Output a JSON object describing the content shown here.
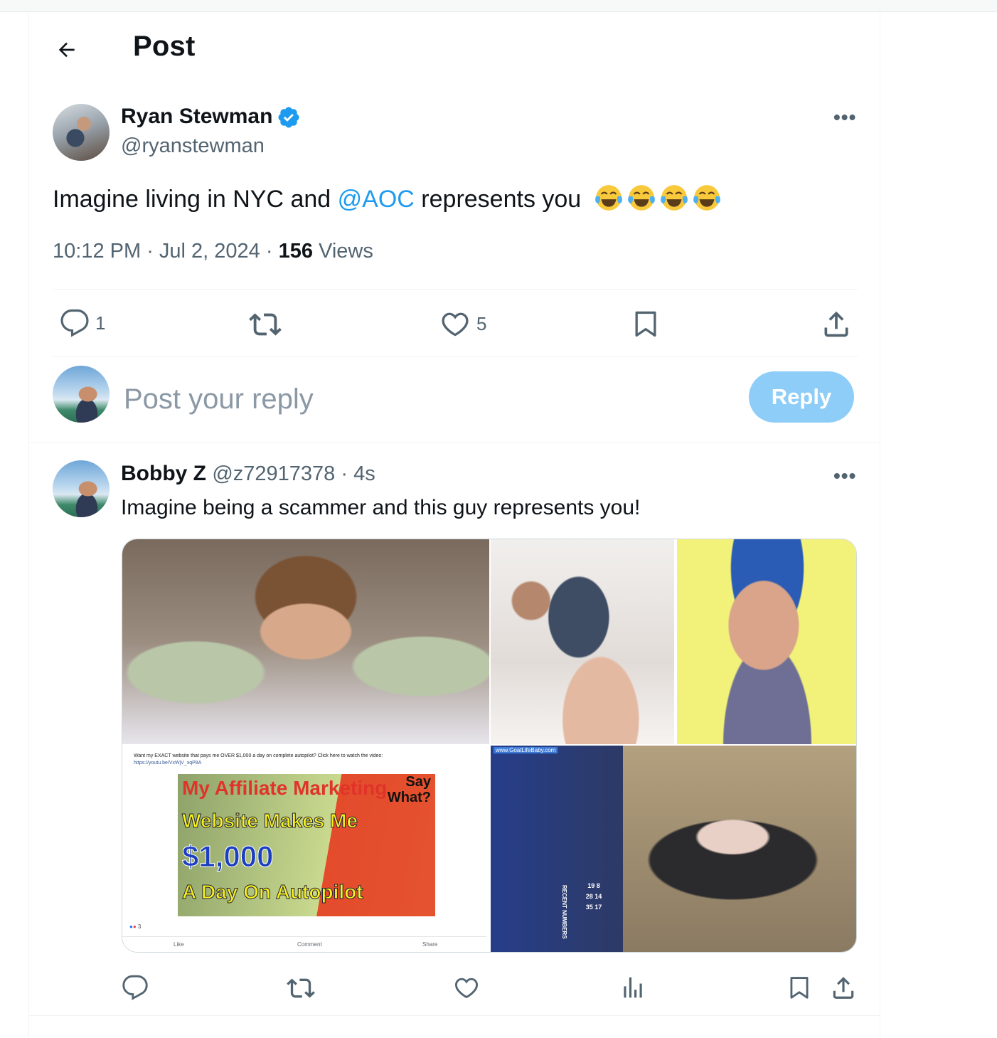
{
  "header": {
    "title": "Post"
  },
  "main_post": {
    "author_name": "Ryan Stewman",
    "handle": "@ryanstewman",
    "text_before": "Imagine living in NYC and ",
    "mention": "@AOC",
    "text_after": " represents you",
    "emoji_count": 4,
    "time": "10:12 PM",
    "date": "Jul 2, 2024",
    "views_count": "156",
    "views_label": "Views",
    "reply_count": "1",
    "like_count": "5"
  },
  "compose": {
    "placeholder": "Post your reply",
    "button_label": "Reply"
  },
  "reply_post": {
    "author_name": "Bobby Z",
    "handle": "@z72917378",
    "time_ago": "4s",
    "text": "Imagine being a scammer and this guy represents you!"
  },
  "media": {
    "fb_caption": "Want my EXACT website that pays me OVER $1,000 a day on complete autopilot? Click here to watch the video:",
    "fb_link": "https://youtu.be/VxWjV_xqP8A",
    "promo_line1": "My Affiliate Marketing",
    "promo_line2": "Website Makes Me",
    "promo_line3": "$1,000",
    "promo_line4": "A Day On Autopilot",
    "promo_say1": "Say",
    "promo_say2": "What?",
    "fb_reactions": "3",
    "fb_like": "Like",
    "fb_comment": "Comment",
    "fb_share": "Share",
    "roulette_tag": "www.GoatLifeBaby.com",
    "roulette_label": "RECENT NUMBERS",
    "roulette_numbers": "19 8 28 14 35 17"
  },
  "colors": {
    "accent": "#1d9bf0",
    "reply_button": "#8ecdf7",
    "muted": "#536471"
  }
}
